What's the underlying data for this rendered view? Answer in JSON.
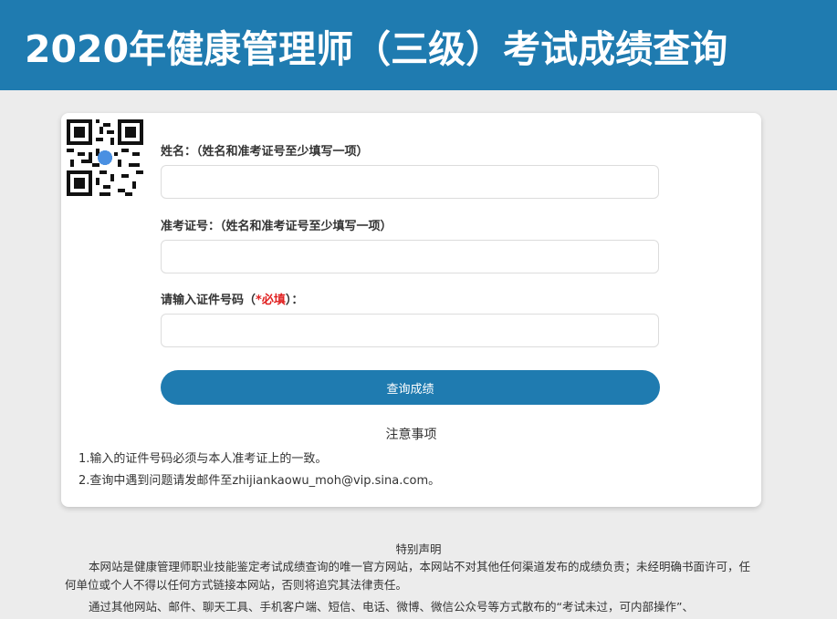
{
  "header": {
    "title": "2020年健康管理师（三级）考试成绩查询"
  },
  "form": {
    "qr_icon": "qr-code-icon",
    "name": {
      "label": "姓名：（姓名和准考证号至少填写一项）",
      "value": "",
      "placeholder": ""
    },
    "ticket": {
      "label": "准考证号：（姓名和准考证号至少填写一项）",
      "value": "",
      "placeholder": ""
    },
    "id_number": {
      "label_prefix": "请输入证件号码（",
      "label_required": "*必填",
      "label_suffix": "）：",
      "value": "",
      "placeholder": ""
    },
    "submit_label": "查询成绩"
  },
  "notes": {
    "title": "注意事项",
    "items": [
      "1.输入的证件号码必须与本人准考证上的一致。",
      "2.查询中遇到问题请发邮件至zhijiankaowu_moh@vip.sina.com。"
    ]
  },
  "disclaimer": {
    "title": "特别声明",
    "paragraphs": [
      "本网站是健康管理师职业技能鉴定考试成绩查询的唯一官方网站，本网站不对其他任何渠道发布的成绩负责；未经明确书面许可，任何单位或个人不得以任何方式链接本网站，否则将追究其法律责任。",
      "通过其他网站、邮件、聊天工具、手机客户端、短信、电话、微博、微信公众号等方式散布的“考试未过，可内部操作”、"
    ]
  },
  "colors": {
    "brand": "#1f7bb0",
    "required": "#e02020",
    "background": "#ececec"
  }
}
